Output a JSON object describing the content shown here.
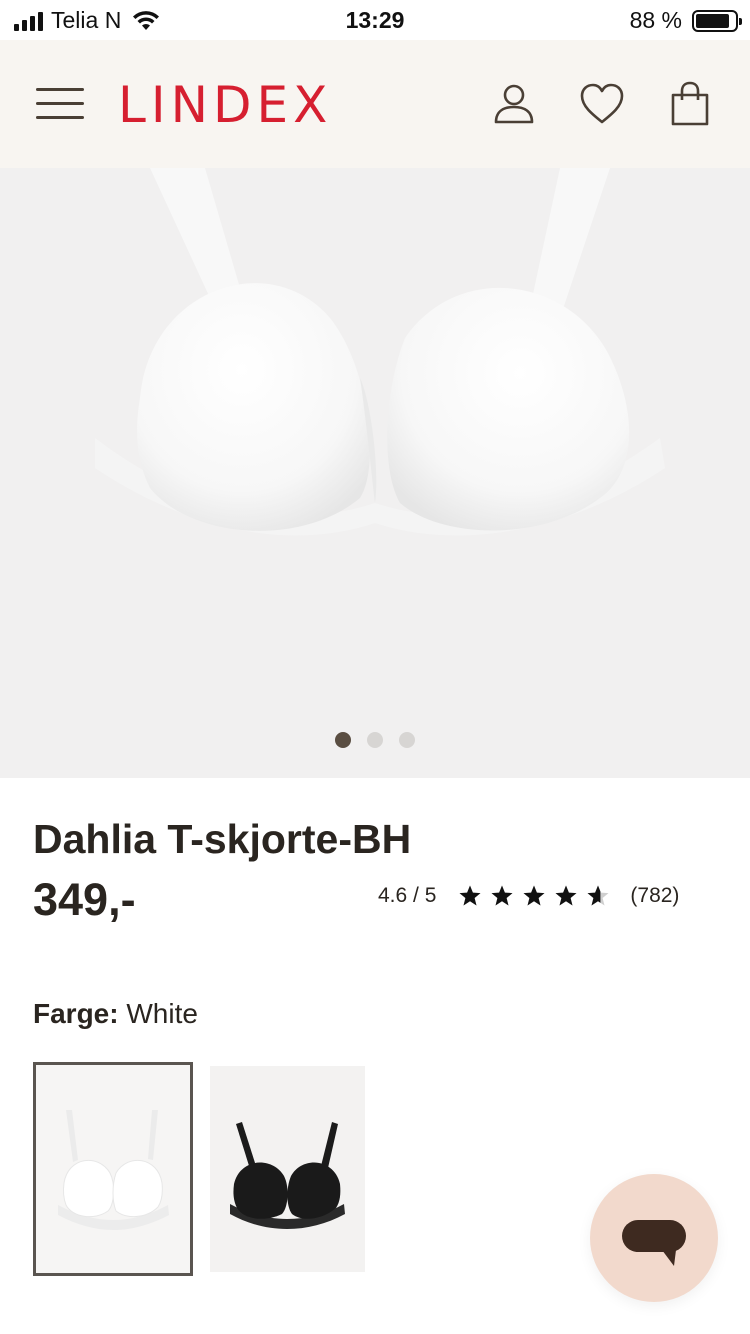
{
  "status_bar": {
    "carrier": "Telia N",
    "time": "13:29",
    "battery_percent": "88 %",
    "battery_level": 0.88
  },
  "header": {
    "logo": "LINDEX",
    "brand_color": "#d61f30",
    "menu_icon": "hamburger-icon",
    "account_icon": "user-icon",
    "wishlist_icon": "heart-icon",
    "cart_icon": "shopping-bag-icon"
  },
  "gallery": {
    "image_count": 3,
    "active_index": 0
  },
  "product": {
    "title": "Dahlia T-skjorte-BH",
    "price": "349,-",
    "rating_text": "4.6 / 5",
    "rating_value": 4.6,
    "rating_max": 5,
    "review_count": "(782)",
    "color_label": "Farge:",
    "color_value": "White",
    "swatches": [
      {
        "name": "White",
        "selected": true
      },
      {
        "name": "Black",
        "selected": false
      }
    ]
  },
  "chat": {
    "icon": "chat-bubble-icon",
    "color": "#f2d9cc"
  }
}
